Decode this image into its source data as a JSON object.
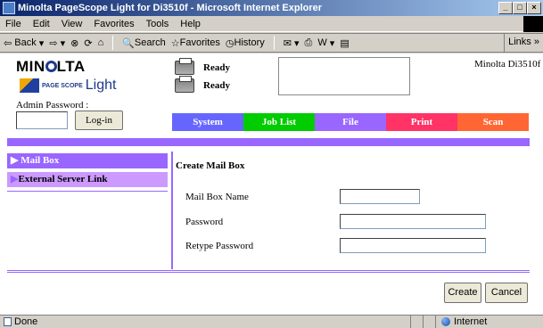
{
  "window": {
    "title": "Minolta PageScope Light for Di3510f - Microsoft Internet Explorer",
    "buttons": [
      "_",
      "□",
      "×"
    ]
  },
  "menu": [
    "File",
    "Edit",
    "View",
    "Favorites",
    "Tools",
    "Help"
  ],
  "toolbar": {
    "back": "Back",
    "search": "Search",
    "favorites": "Favorites",
    "history": "History",
    "links": "Links"
  },
  "header": {
    "brand": "MIN",
    "brand_suffix": "LTA",
    "logo_small": "PAGE SCOPE",
    "logo_light": "Light",
    "admin_label": "Admin Password :",
    "login_button": "Log-in",
    "status1": "Ready",
    "status2": "Ready",
    "model": "Minolta Di3510f"
  },
  "tabs": [
    {
      "label": "System",
      "color": "#6666ff"
    },
    {
      "label": "Job List",
      "color": "#00cc00"
    },
    {
      "label": "File",
      "color": "#9966ff"
    },
    {
      "label": "Print",
      "color": "#ff3366"
    },
    {
      "label": "Scan",
      "color": "#ff6633"
    }
  ],
  "sidebar": {
    "items": [
      {
        "label": "Mail Box",
        "active": true
      },
      {
        "label": "External Server Link",
        "active": false
      }
    ]
  },
  "form": {
    "title": "Create Mail Box",
    "fields": [
      {
        "label": "Mail Box Name",
        "value": ""
      },
      {
        "label": "Password",
        "value": ""
      },
      {
        "label": "Retype Password",
        "value": ""
      }
    ],
    "create": "Create",
    "cancel": "Cancel"
  },
  "statusbar": {
    "text": "Done",
    "zone": "Internet"
  },
  "colors": {
    "accent": "#9966ff",
    "sidebar_inactive": "#cc99ff"
  }
}
